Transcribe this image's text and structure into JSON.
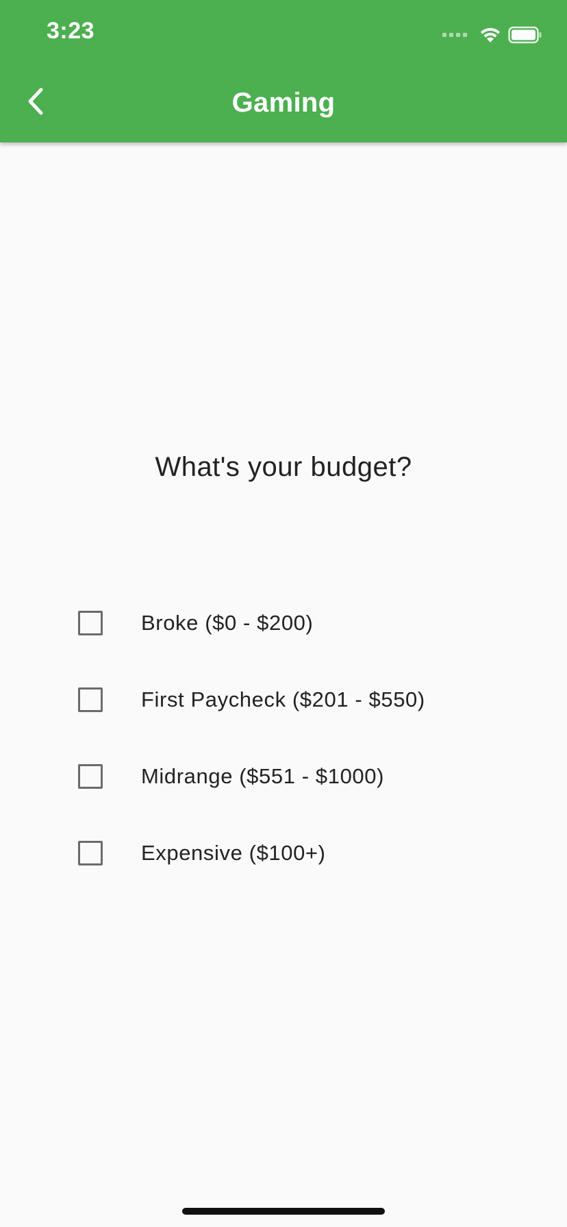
{
  "status_bar": {
    "time": "3:23"
  },
  "app_bar": {
    "title": "Gaming",
    "back_icon": "chevron-left-icon",
    "background_color": "#4caf50"
  },
  "question": {
    "text": "What's your budget?"
  },
  "options": [
    {
      "label": "Broke ($0 - $200)",
      "checked": false
    },
    {
      "label": "First Paycheck ($201 - $550)",
      "checked": false
    },
    {
      "label": "Midrange ($551 - $1000)",
      "checked": false
    },
    {
      "label": "Expensive ($100+)",
      "checked": false
    }
  ]
}
